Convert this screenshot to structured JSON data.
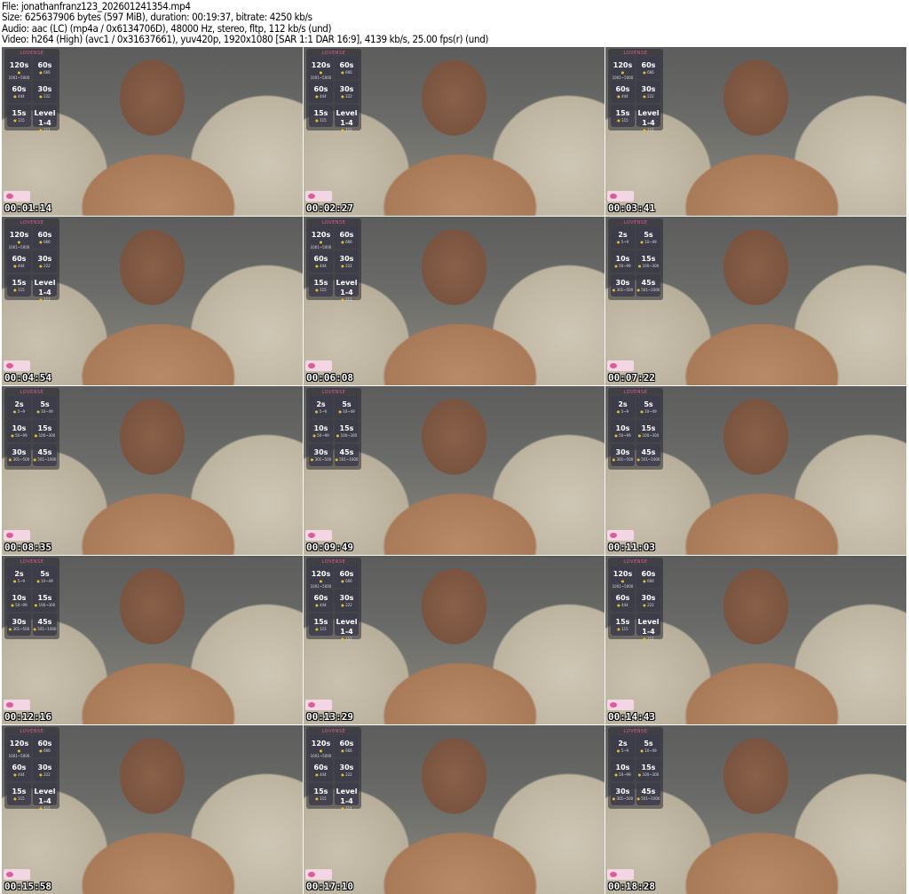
{
  "header": {
    "file": "File: jonathanfranz123_202601241354.mp4",
    "size": "Size: 625637906 bytes (597 MiB), duration: 00:19:37, bitrate: 4250 kb/s",
    "audio": "Audio: aac (LC) (mp4a / 0x6134706D), 48000 Hz, stereo, fltp, 112 kb/s (und)",
    "video": "Video: h264 (High) (avc1 / 0x31637661), yuv420p, 1920x1080 [SAR 1:1 DAR 16:9], 4139 kb/s, 25.00 fps(r) (und)"
  },
  "overlay_brand": "LOVENSE",
  "tip_menus": {
    "A": [
      {
        "value": "120s",
        "range": "1001~5000"
      },
      {
        "value": "60s",
        "range": "666"
      },
      {
        "value": "60s",
        "range": "444"
      },
      {
        "value": "30s",
        "range": "222"
      },
      {
        "value": "15s",
        "range": "115"
      },
      {
        "value": "Level 1-4",
        "range": "111"
      }
    ],
    "B": [
      {
        "value": "2s",
        "range": "5~9"
      },
      {
        "value": "5s",
        "range": "10~49"
      },
      {
        "value": "10s",
        "range": "50~99"
      },
      {
        "value": "15s",
        "range": "100~300"
      },
      {
        "value": "30s",
        "range": "301~500"
      },
      {
        "value": "45s",
        "range": "501~1000"
      }
    ]
  },
  "thumbnails": [
    {
      "timestamp": "00:01:14",
      "menu": "A"
    },
    {
      "timestamp": "00:02:27",
      "menu": "A"
    },
    {
      "timestamp": "00:03:41",
      "menu": "A"
    },
    {
      "timestamp": "00:04:54",
      "menu": "A"
    },
    {
      "timestamp": "00:06:08",
      "menu": "A"
    },
    {
      "timestamp": "00:07:22",
      "menu": "B"
    },
    {
      "timestamp": "00:08:35",
      "menu": "B"
    },
    {
      "timestamp": "00:09:49",
      "menu": "B"
    },
    {
      "timestamp": "00:11:03",
      "menu": "B"
    },
    {
      "timestamp": "00:12:16",
      "menu": "B"
    },
    {
      "timestamp": "00:13:29",
      "menu": "A"
    },
    {
      "timestamp": "00:14:43",
      "menu": "A"
    },
    {
      "timestamp": "00:15:58",
      "menu": "A"
    },
    {
      "timestamp": "00:17:10",
      "menu": "A"
    },
    {
      "timestamp": "00:18:28",
      "menu": "B"
    }
  ]
}
